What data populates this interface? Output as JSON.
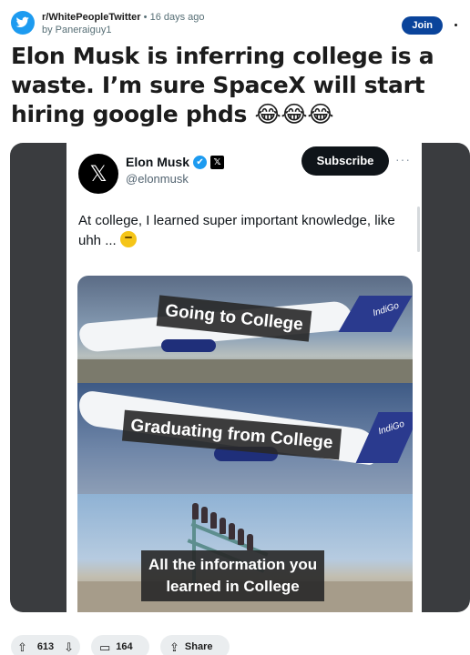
{
  "post": {
    "subreddit": "r/WhitePeopleTwitter",
    "separator": "•",
    "age": "16 days ago",
    "author": "by Paneraiguy1",
    "join_label": "Join",
    "title": "Elon Musk is inferring college is a waste. I’m sure SpaceX will start hiring google phds 😂😂😂"
  },
  "tweet": {
    "avatar_glyph": "𝕏",
    "name": "Elon Musk",
    "verified_glyph": "✔",
    "xbadge_glyph": "𝕏",
    "handle": "@elonmusk",
    "subscribe_label": "Subscribe",
    "more_glyph": "···",
    "text": "At college, I learned super important knowledge, like uhh ..."
  },
  "meme": {
    "panel1_caption": "Going to College",
    "panel2_caption": "Graduating from College",
    "panel3_caption_line1": "All the information you",
    "panel3_caption_line2": "learned in College",
    "plane_brand": "IndiGo"
  },
  "actions": {
    "upvote_icon": "⇧",
    "votes": "613",
    "downvote_icon": "⇩",
    "comment_icon": "▭",
    "comments": "164",
    "share_icon": "⇪",
    "share_label": "Share"
  },
  "colors": {
    "join_button": "#0a449b",
    "subreddit_icon": "#1d9bf0",
    "tweet_verified": "#1d9bf0",
    "indigo_blue": "#1f2f7a"
  }
}
